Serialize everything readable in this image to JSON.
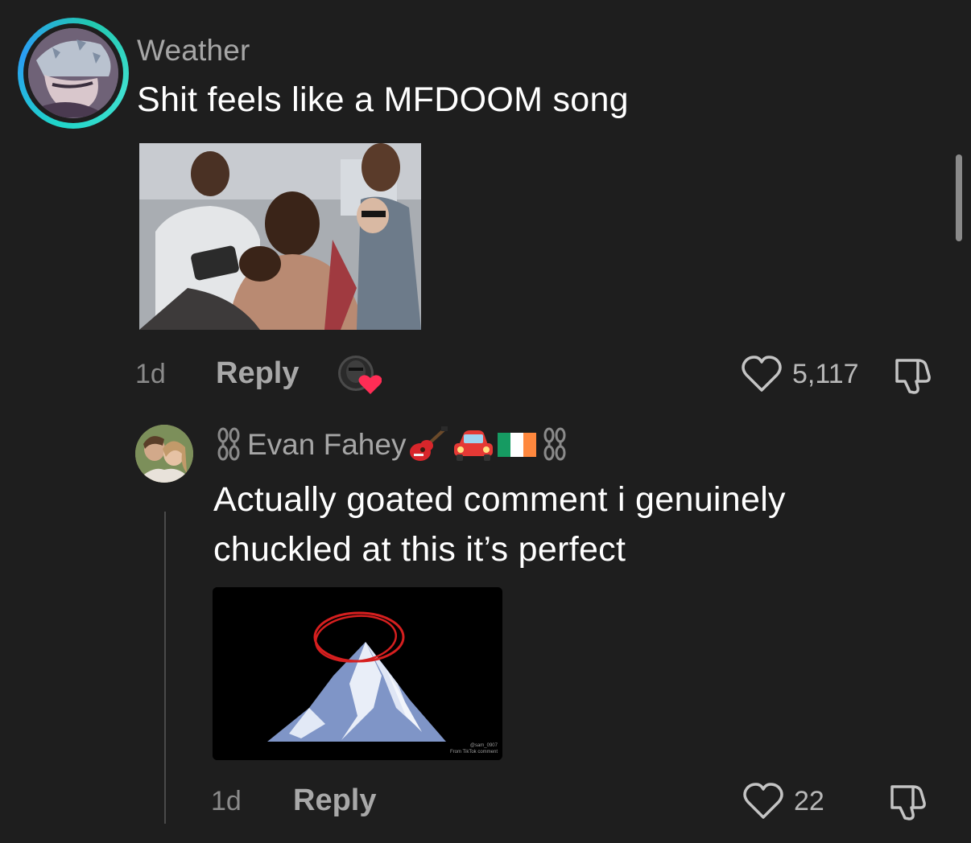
{
  "comment": {
    "username": "Weather",
    "text": "Shit feels like a MFDOOM song",
    "time": "1d",
    "reply_label": "Reply",
    "like_count": "5,117"
  },
  "reply": {
    "username": "Evan Fahey",
    "text": "Actually goated comment i genuinely chuckled at this it’s perfect",
    "time": "1d",
    "reply_label": "Reply",
    "like_count": "22",
    "gif_watermark_user": "@sam_0907",
    "gif_watermark_source": "From TikTok comment"
  },
  "icons": {
    "like": "heart-outline-icon",
    "dislike": "thumbs-down-icon",
    "creator_liked": "heart-icon",
    "chain": "chain-icon",
    "guitar": "guitar-emoji",
    "car": "car-emoji",
    "flag": "ireland-flag-emoji"
  },
  "colors": {
    "background": "#1e1e1e",
    "avatar_ring": "#1fd4c9",
    "creator_heart": "#ff2d55",
    "secondary_text": "#a6a6a6"
  }
}
